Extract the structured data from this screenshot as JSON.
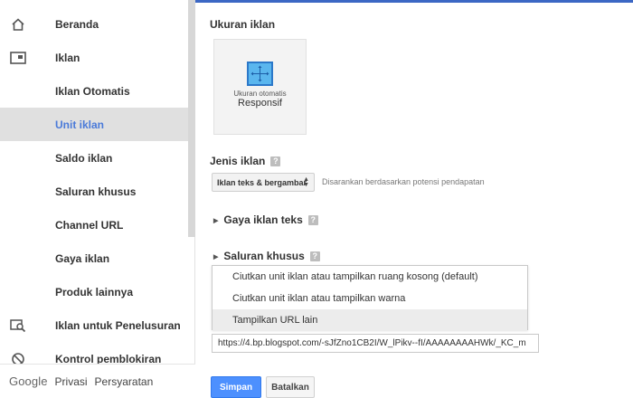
{
  "sidebar": {
    "items": [
      {
        "label": "Beranda",
        "icon": "home-icon"
      },
      {
        "label": "Iklan",
        "icon": "ad-unit-icon"
      },
      {
        "label": "Iklan Otomatis",
        "icon": ""
      },
      {
        "label": "Unit iklan",
        "icon": "",
        "active": true
      },
      {
        "label": "Saldo iklan",
        "icon": ""
      },
      {
        "label": "Saluran khusus",
        "icon": ""
      },
      {
        "label": "Channel URL",
        "icon": ""
      },
      {
        "label": "Gaya iklan",
        "icon": ""
      },
      {
        "label": "Produk lainnya",
        "icon": ""
      },
      {
        "label": "Iklan untuk Penelusuran",
        "icon": "search-ads-icon"
      },
      {
        "label": "Kontrol pemblokiran",
        "icon": "block-icon"
      }
    ],
    "footer": {
      "brand": "Google",
      "privacy": "Privasi",
      "terms": "Persyaratan"
    }
  },
  "main": {
    "ad_size_title": "Ukuran iklan",
    "size_card": {
      "line1": "Ukuran otomatis",
      "line2": "Responsif"
    },
    "ad_type_title": "Jenis iklan",
    "ad_type_select": "Iklan teks & bergambar",
    "ad_type_hint": "Disarankan berdasarkan potensi pendapatan",
    "text_ad_style": "Gaya iklan teks",
    "custom_channels": "Saluran khusus",
    "fallback_options": [
      "Ciutkan unit iklan atau tampilkan ruang kosong (default)",
      "Ciutkan unit iklan atau tampilkan warna",
      "Tampilkan URL lain"
    ],
    "fallback_url": "https://4.bp.blogspot.com/-sJfZno1CB2I/W_lPikv--fI/AAAAAAAAHWk/_KC_m",
    "save_label": "Simpan",
    "cancel_label": "Batalkan",
    "help_glyph": "?"
  },
  "colors": {
    "accent": "#3c67c4",
    "active_text": "#4a7ad9",
    "save_button": "#4d90fe"
  }
}
